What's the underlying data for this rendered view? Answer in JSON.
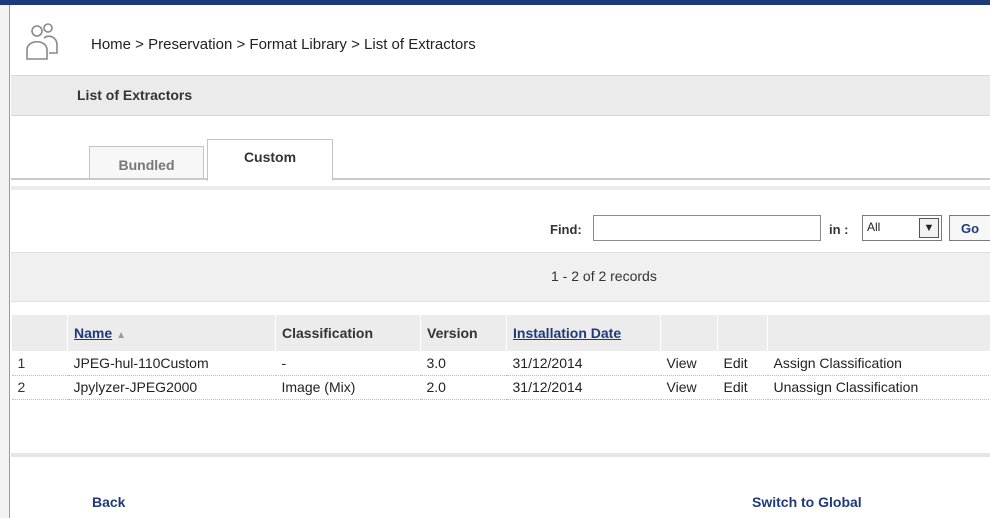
{
  "header": {
    "breadcrumb": "Home > Preservation > Format Library > List of Extractors",
    "logo_icon": "users-group-icon"
  },
  "page": {
    "title": "List of Extractors"
  },
  "tabs": [
    {
      "label": "Bundled",
      "active": false
    },
    {
      "label": "Custom",
      "active": true
    }
  ],
  "find": {
    "label": "Find:",
    "value": "",
    "in_label": "in :",
    "in_selected": "All",
    "go_label": "Go"
  },
  "records": {
    "summary": "1 - 2 of 2 records"
  },
  "table": {
    "columns": [
      "",
      "Name",
      "Classification",
      "Version",
      "Installation Date",
      "",
      "",
      ""
    ],
    "sort_column": "Name",
    "sort_direction": "ascending",
    "rows": [
      {
        "num": "1",
        "name": "JPEG-hul-110Custom",
        "classification": "-",
        "version": "3.0",
        "date": "31/12/2014",
        "view": "View",
        "edit": "Edit",
        "action": "Assign Classification"
      },
      {
        "num": "2",
        "name": "Jpylyzer-JPEG2000",
        "classification": "Image (Mix)",
        "version": "2.0",
        "date": "31/12/2014",
        "view": "View",
        "edit": "Edit",
        "action": "Unassign Classification"
      }
    ]
  },
  "footer": {
    "back_label": "Back",
    "switch_label": "Switch to Global"
  },
  "colors": {
    "accent": "#1f3a7a",
    "header_bar": "#ebebeb"
  }
}
